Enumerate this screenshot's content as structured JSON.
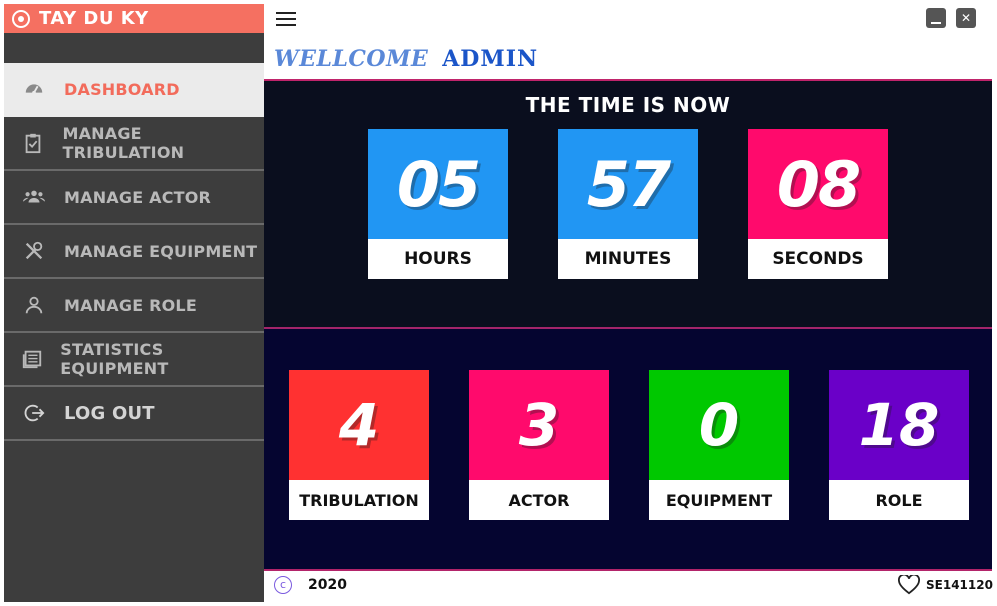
{
  "brand": {
    "title": "TAY DU KY"
  },
  "sidebar": {
    "items": [
      {
        "label": "DASHBOARD",
        "icon": "dashboard-gauge-icon",
        "active": true
      },
      {
        "label": "MANAGE TRIBULATION",
        "icon": "clipboard-check-icon"
      },
      {
        "label": "MANAGE ACTOR",
        "icon": "users-group-icon"
      },
      {
        "label": "MANAGE EQUIPMENT",
        "icon": "tools-icon"
      },
      {
        "label": "MANAGE ROLE",
        "icon": "user-icon"
      },
      {
        "label": "STATISTICS EQUIPMENT",
        "icon": "list-document-icon"
      },
      {
        "label": "LOG OUT",
        "icon": "logout-icon"
      }
    ]
  },
  "header": {
    "welcome": "WELLCOME",
    "user": "ADMIN"
  },
  "clock": {
    "title": "THE TIME IS NOW",
    "hours": {
      "value": "05",
      "label": "HOURS",
      "color": "#2196f3"
    },
    "minutes": {
      "value": "57",
      "label": "MINUTES",
      "color": "#2196f3"
    },
    "seconds": {
      "value": "08",
      "label": "SECONDS",
      "color": "#ff0a6c"
    }
  },
  "stats": [
    {
      "value": "4",
      "label": "TRIBULATION",
      "color": "#ff3131"
    },
    {
      "value": "3",
      "label": "ACTOR",
      "color": "#ff0a6c"
    },
    {
      "value": "0",
      "label": "EQUIPMENT",
      "color": "#00c800"
    },
    {
      "value": "18",
      "label": "ROLE",
      "color": "#6a00c8"
    }
  ],
  "footer": {
    "year": "2020",
    "student_id": "SE141120"
  },
  "colors": {
    "brand": "#f57061",
    "sidebar": "#3d3d3d",
    "accent_line": "#c0246b"
  }
}
